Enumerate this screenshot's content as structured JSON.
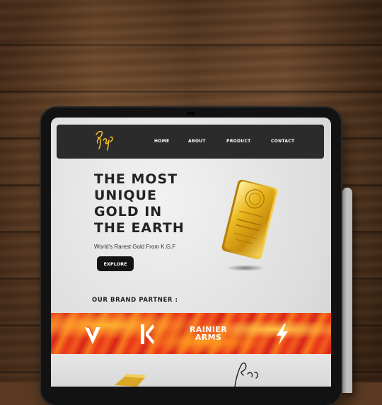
{
  "logo": {
    "text": "Rocky"
  },
  "nav": {
    "links": [
      {
        "label": "HOME"
      },
      {
        "label": "ABOUT"
      },
      {
        "label": "PRODUCT"
      },
      {
        "label": "CONTACT"
      }
    ]
  },
  "hero": {
    "title_lines": [
      "THE MOST",
      "UNIQUE",
      "GOLD IN",
      "THE EARTH"
    ],
    "subtitle": "World's Rarest Gold From K.G.F",
    "cta_label": "EXPLORE"
  },
  "partners": {
    "title": "OUR BRAND PARTNER :",
    "brands": [
      {
        "icon": "v-logo-icon"
      },
      {
        "icon": "k-logo-icon"
      },
      {
        "line1": "RAINIER",
        "line2": "ARMS"
      },
      {
        "icon": "lightning-logo-icon"
      }
    ]
  },
  "colors": {
    "nav_bg": "#2b2b2b",
    "accent_gold": "#f0b72a",
    "button_bg": "#141414",
    "band_red": "#e8361a",
    "band_orange": "#f7781e"
  }
}
